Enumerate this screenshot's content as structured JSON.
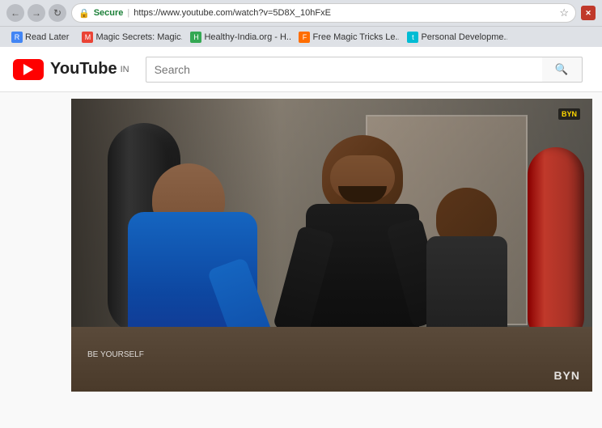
{
  "browser": {
    "address_bar": {
      "secure_label": "Secure",
      "separator": "|",
      "url": "https://www.youtube.com/watch?v=5D8X_10hFxE",
      "star_icon": "☆"
    },
    "bookmarks": [
      {
        "id": "read-later",
        "label": "Read Later",
        "icon_type": "blue",
        "icon_char": "R"
      },
      {
        "id": "magic-secrets",
        "label": "Magic Secrets: Magic...",
        "icon_type": "red",
        "icon_char": "M"
      },
      {
        "id": "healthy-india",
        "label": "Healthy-India.org - H...",
        "icon_type": "green",
        "icon_char": "H"
      },
      {
        "id": "free-magic",
        "label": "Free Magic Tricks Le...",
        "icon_type": "orange",
        "icon_char": "F"
      },
      {
        "id": "personal-dev",
        "label": "Personal Developme...",
        "icon_type": "teal",
        "icon_char": "t"
      }
    ]
  },
  "youtube": {
    "logo_text": "YouTube",
    "logo_country": "IN",
    "search_placeholder": "Search",
    "search_button_label": "🔍"
  },
  "video": {
    "watermark": "BYN",
    "badge_text": "BYN",
    "subtitle": "BE YOURSELF"
  }
}
